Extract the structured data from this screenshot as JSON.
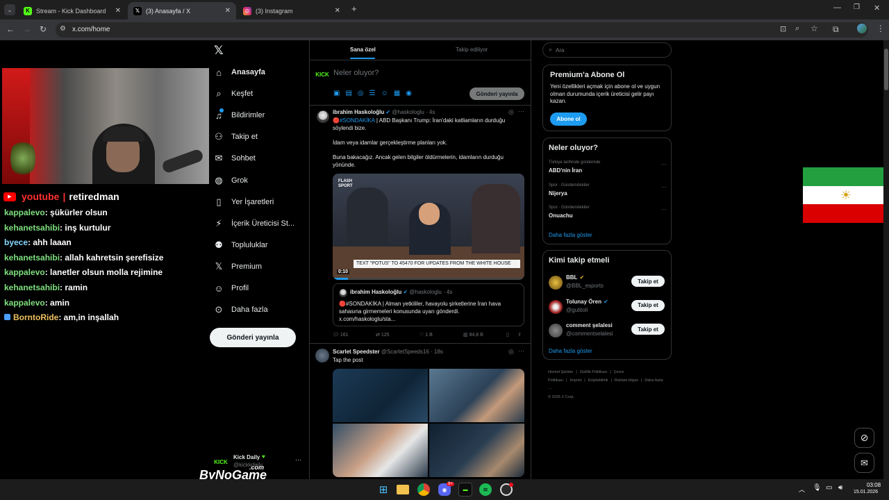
{
  "browser": {
    "tabs": [
      {
        "title": "Stream - Kick Dashboard",
        "favicon": "kick-icon"
      },
      {
        "title": "(3) Anasayfa / X",
        "favicon": "x-icon"
      },
      {
        "title": "(3) Instagram",
        "favicon": "instagram-icon"
      }
    ],
    "url": "x.com/home"
  },
  "stream": {
    "channel_platform": "youtube",
    "channel_name": "retiredman",
    "chat": [
      {
        "user": "kappalevo",
        "msg": ": şükürler olsun",
        "color": "#7ee07e"
      },
      {
        "user": "kehanetsahibi",
        "msg": ": inş kurtulur",
        "color": "#7ee07e"
      },
      {
        "user": "byece",
        "msg": ": ahh laaan",
        "color": "#86d7ff"
      },
      {
        "user": "kehanetsahibi",
        "msg": ": allah kahretsin şerefisize",
        "color": "#7ee07e"
      },
      {
        "user": "kappalevo",
        "msg": ": lanetler olsun molla rejimine",
        "color": "#7ee07e"
      },
      {
        "user": "kehanetsahibi",
        "msg": ": ramin",
        "color": "#7ee07e"
      },
      {
        "user": "kappalevo",
        "msg": ": amin",
        "color": "#7ee07e"
      },
      {
        "user": "BorntoRide",
        "msg": ": am,in inşallah",
        "color": "#f0c060"
      }
    ],
    "watermark": "ByNoGame",
    "watermark_sub": ".com"
  },
  "nav": {
    "items": [
      {
        "label": "Anasayfa",
        "icon": "home-icon"
      },
      {
        "label": "Keşfet",
        "icon": "search-icon"
      },
      {
        "label": "Bildirimler",
        "icon": "bell-icon"
      },
      {
        "label": "Takip et",
        "icon": "add-person-icon"
      },
      {
        "label": "Sohbet",
        "icon": "chat-icon"
      },
      {
        "label": "Grok",
        "icon": "grok-icon"
      },
      {
        "label": "Yer İşaretleri",
        "icon": "bookmark-icon"
      },
      {
        "label": "İçerik Üreticisi St...",
        "icon": "creator-icon"
      },
      {
        "label": "Topluluklar",
        "icon": "communities-icon"
      },
      {
        "label": "Premium",
        "icon": "x-icon"
      },
      {
        "label": "Profil",
        "icon": "profile-icon"
      },
      {
        "label": "Daha fazla",
        "icon": "more-icon"
      }
    ],
    "post_button": "Gönderi yayınla",
    "account": {
      "name": "Kick Daily",
      "handle": "@kickkdaily"
    }
  },
  "feed": {
    "tabs": [
      "Sana özel",
      "Takip ediliyor"
    ],
    "composer_placeholder": "Neler oluyor?",
    "composer_button": "Gönderi yayınla",
    "post1": {
      "author": "ibrahim Haskoloğlu",
      "handle": "@haskologlu",
      "time": "· 4s",
      "line1_tag": "🔴#SONDAKİKA",
      "line1_text": " | ABD Başkanı Trump: İran'daki katliamların durduğu söylendi bize.",
      "line2": "İdam veya idamlar gerçekleştirme planları yok.",
      "line3": "Buna bakacağız. Ancak gelen bilgiler öldürmelerin, idamların durduğu yönünde.",
      "video_caption": "TEXT \"POTUS\" TO 45470 FOR UPDATES FROM THE WHITE HOUSE",
      "video_time": "0:10",
      "video_brand": "FLASH SPORT",
      "quote_author": "ibrahim Haskoloğlu",
      "quote_handle": "@haskologlu",
      "quote_time": "· 4s",
      "quote_text": "🔴#SONDAKİKA | Alman yetkililer, havayolu şirketlerine İran hava sahasına girmemeleri konusunda uyarı gönderdi. x.com/haskologlu/sta...",
      "replies": "161",
      "reposts": "125",
      "likes": "1 B",
      "views": "84,8 B"
    },
    "post2": {
      "author": "Scarlet Speedster",
      "handle": "@ScarletSpeeds16",
      "time": "· 18s",
      "text": "Tap the post"
    }
  },
  "sidebar": {
    "search_placeholder": "Ara",
    "premium": {
      "title": "Premium'a Abone Ol",
      "text": "Yeni özellikleri açmak için abone ol ve uygun olman durumunda içerik üreticisi gelir payı kazan.",
      "button": "Abone ol"
    },
    "trends": {
      "title": "Neler oluyor?",
      "items": [
        {
          "context": "Türkiye tarihinde gündemde",
          "name": "ABD'nin İran"
        },
        {
          "context": "Spor · Gündemdekiler",
          "name": "Nijerya"
        },
        {
          "context": "Spor · Gündemdekiler",
          "name": "Onuachu"
        }
      ],
      "more": "Daha fazla göster"
    },
    "who_to_follow": {
      "title": "Kimi takip etmeli",
      "items": [
        {
          "name": "BBL",
          "handle": "@BBL_esports",
          "button": "Takip et"
        },
        {
          "name": "Tolunay Ören",
          "handle": "@gutitoli",
          "button": "Takip et"
        },
        {
          "name": "comment şelalesi",
          "handle": "@commentselalesi",
          "button": "Takip et"
        }
      ],
      "more": "Daha fazla göster"
    },
    "footer": {
      "links": [
        "Hizmet Şartları",
        "Gizlilik Politikası",
        "Çerez Politikası",
        "Imprint",
        "Erişilebilirlik",
        "Reklam bilgisi",
        "Daha fazla ···"
      ],
      "copyright": "© 2026 X Corp."
    }
  },
  "taskbar": {
    "time": "03:08",
    "date": "15.01.2026",
    "discord_badge": "9+"
  }
}
